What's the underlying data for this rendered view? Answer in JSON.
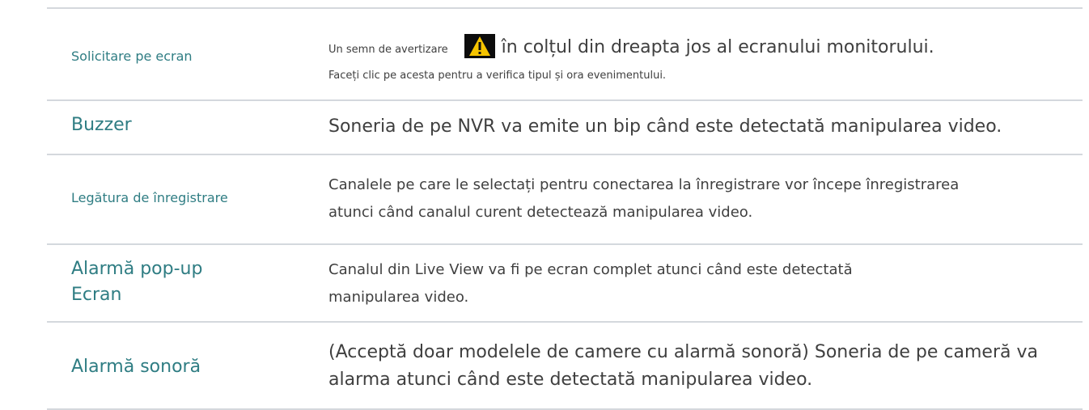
{
  "rows": [
    {
      "label": "Solicitare pe ecran",
      "desc_prefix": "Un semn de avertizare",
      "desc_main": "în colțul din dreapta jos al ecranului monitorului.",
      "desc_note": "Faceți clic pe acesta pentru a verifica tipul și ora evenimentului.",
      "icon": "warning-triangle-icon"
    },
    {
      "label": "Buzzer",
      "desc": "Soneria de pe NVR va emite un bip când este detectată manipularea video."
    },
    {
      "label": "Legătura de înregistrare",
      "desc_line1": "Canalele pe care le selectați pentru conectarea la înregistrare vor începe înregistrarea",
      "desc_line2": "atunci când canalul curent detectează manipularea video."
    },
    {
      "label_line1": "Alarmă pop-up",
      "label_line2": "Ecran",
      "desc_line1": "Canalul din Live View va fi pe ecran complet atunci când este detectată",
      "desc_line2": "manipularea video."
    },
    {
      "label": "Alarmă sonoră",
      "desc_line1": "(Acceptă doar modelele de camere cu alarmă sonoră) Soneria de pe cameră va",
      "desc_line2": "alarma atunci când este detectată manipularea video."
    }
  ],
  "colors": {
    "label": "#2f7d83",
    "text": "#3f3f3f",
    "divider": "#d4d8dd",
    "icon_bg": "#0c0c0c",
    "icon_fg": "#f5c400"
  }
}
